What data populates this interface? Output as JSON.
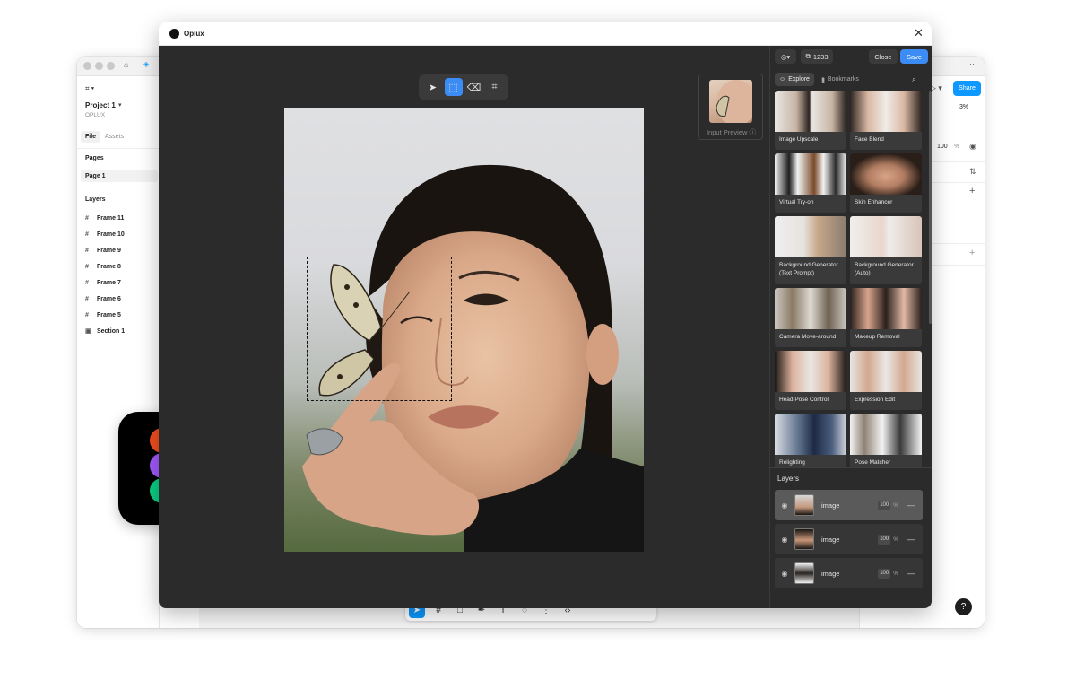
{
  "figma": {
    "project_name": "Project 1",
    "team_name": "OPLUX",
    "tab_file": "File",
    "tab_assets": "Assets",
    "pages_heading": "Pages",
    "page_1": "Page 1",
    "layers_heading": "Layers",
    "layers": [
      "Frame 11",
      "Frame 10",
      "Frame 9",
      "Frame 8",
      "Frame 7",
      "Frame 6",
      "Frame 5",
      "Section 1"
    ],
    "share_label": "Share",
    "zoom": "3%",
    "opacity_value": "100",
    "opacity_unit": "%"
  },
  "modal": {
    "title": "Oplux",
    "input_preview_label": "Input Preview",
    "credits": "1233",
    "close_label": "Close",
    "save_label": "Save",
    "tab_explore": "Explore",
    "tab_bookmarks": "Bookmarks",
    "tools": [
      "Image Upscale",
      "Face Blend",
      "Virtual Try-on",
      "Skin Enhancer",
      "Background Generator (Text Prompt)",
      "Background Generator (Auto)",
      "Camera Move-around",
      "Makeup Removal",
      "Head Pose Control",
      "Expression Edit",
      "Relighting",
      "Pose Matcher"
    ],
    "layers_heading": "Layers",
    "layers": [
      {
        "name": "image",
        "opacity": "100",
        "unit": "%"
      },
      {
        "name": "image",
        "opacity": "100",
        "unit": "%"
      },
      {
        "name": "image",
        "opacity": "100",
        "unit": "%"
      }
    ]
  },
  "colors": {
    "accent": "#3b8df5",
    "figma_blue": "#0d99ff",
    "dark_panel": "#2b2b2b"
  }
}
